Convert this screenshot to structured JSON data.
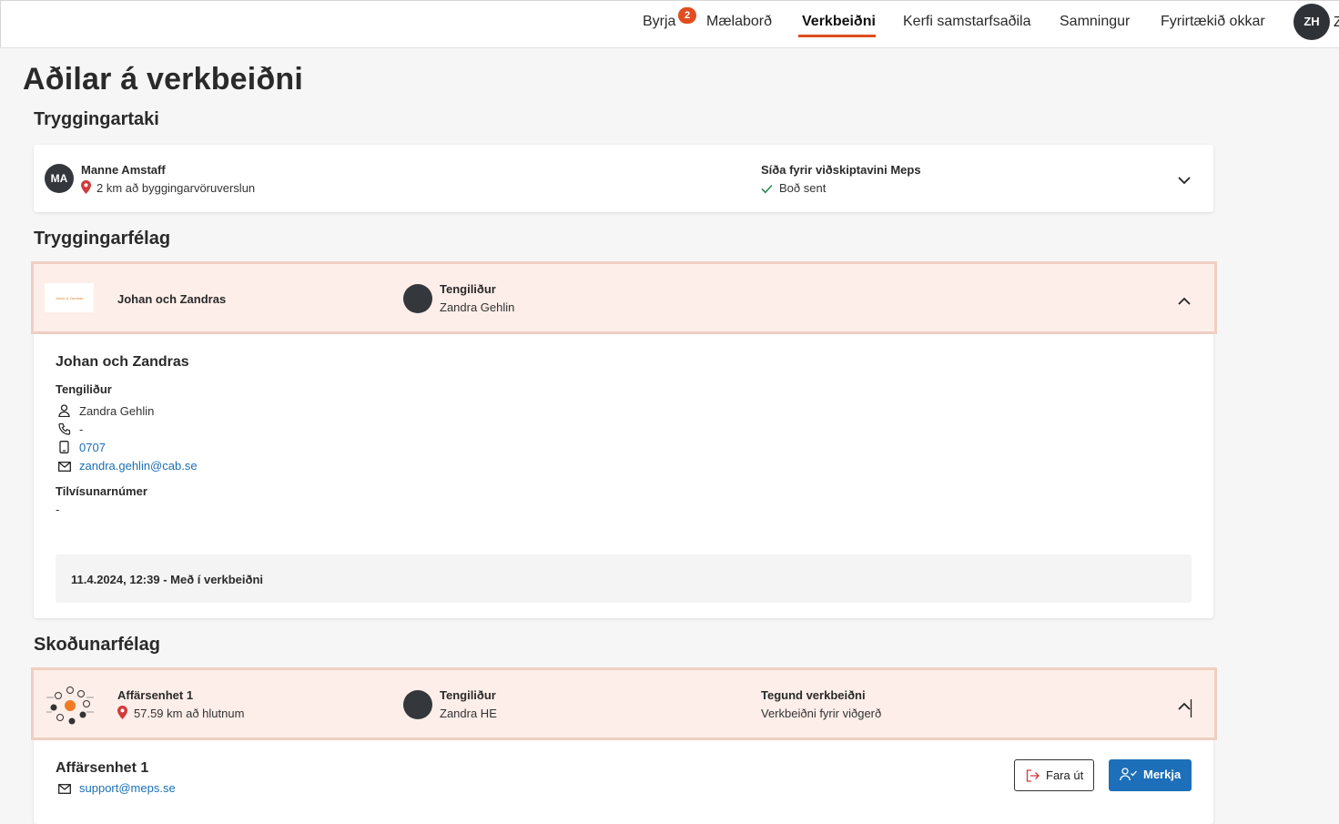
{
  "nav": {
    "items": [
      "Byrja",
      "Mælaborð",
      "Verkbeiðni",
      "Kerfi samstarfsaðila",
      "Samningur",
      "Fyrirtækið okkar"
    ],
    "badge": "2",
    "avatar": "ZH",
    "avatar_tail": "Z"
  },
  "page_title": "Aðilar á verkbeiðni",
  "sections": {
    "policyholder": "Tryggingartaki",
    "insurer": "Tryggingarfélag",
    "inspector": "Skoðunarfélag"
  },
  "policyholder_card": {
    "initials": "MA",
    "name": "Manne Amstaff",
    "distance": "2 km að byggingarvöruverslun",
    "page_label": "Síða fyrir viðskiptavini Meps",
    "status": "Boð sent"
  },
  "insurer_card": {
    "logo_text": "Johan & Zandras",
    "name": "Johan och Zandras",
    "contact_label": "Tengiliður",
    "contact_name": "Zandra Gehlin"
  },
  "insurer_detail": {
    "title": "Johan och Zandras",
    "contact_label": "Tengiliður",
    "person": "Zandra Gehlin",
    "phone": "-",
    "mobile": "0707",
    "email": "zandra.gehlin@cab.se",
    "reference_label": "Tilvísunarnúmer",
    "reference_value": "-",
    "history": "11.4.2024, 12:39 - Með í verkbeiðni"
  },
  "inspector_card": {
    "name": "Affärsenhet 1",
    "distance": "57.59 km að hlutnum",
    "contact_label": "Tengiliður",
    "contact_name": "Zandra HE",
    "type_label": "Tegund verkbeiðni",
    "type_value": "Verkbeiðni fyrir viðgerð"
  },
  "inspector_detail": {
    "title": "Affärsenhet 1",
    "email": "support@meps.se",
    "leave_button": "Fara út",
    "assign_button": "Merkja"
  },
  "colors": {
    "accent": "#e04d1f",
    "primary": "#1c6fb8",
    "highlight_bg": "#fdeee9",
    "highlight_border": "#efcfc2",
    "success": "#2e8b57",
    "pin": "#d33a3a"
  }
}
